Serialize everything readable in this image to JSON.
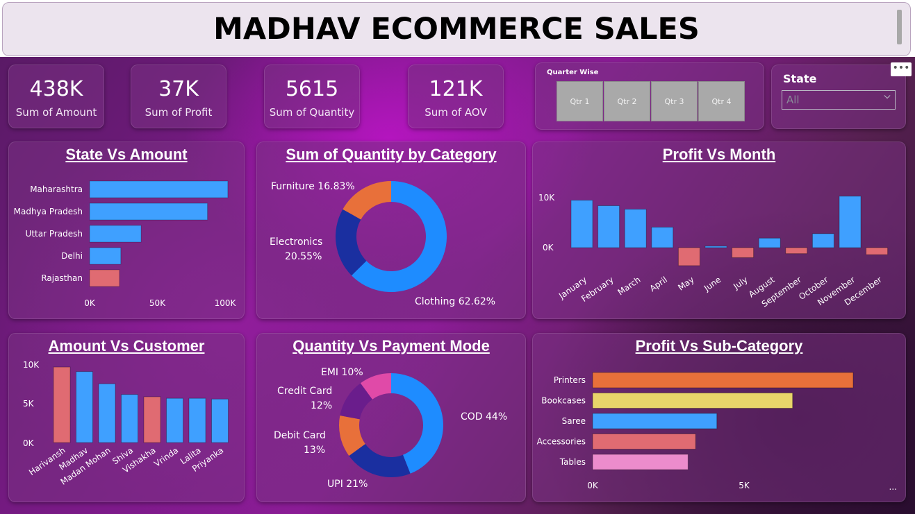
{
  "header": {
    "title": "MADHAV ECOMMERCE SALES"
  },
  "kpis": [
    {
      "value": "438K",
      "label": "Sum of Amount"
    },
    {
      "value": "37K",
      "label": "Sum of Profit"
    },
    {
      "value": "5615",
      "label": "Sum of Quantity"
    },
    {
      "value": "121K",
      "label": "Sum of AOV"
    }
  ],
  "quarter_slicer": {
    "title": "Quarter Wise",
    "options": [
      "Qtr 1",
      "Qtr 2",
      "Qtr 3",
      "Qtr 4"
    ]
  },
  "state_slicer": {
    "title": "State",
    "selected": "All"
  },
  "colors": {
    "blue": "#3fa0ff",
    "salmon": "#e06b72",
    "orange": "#e8703a",
    "navy": "#1a2fa0",
    "yellow": "#e8d56a",
    "pink": "#ec8ccc",
    "magenta": "#e04aa8",
    "purple": "#6a1d8c"
  },
  "chart_data": [
    {
      "id": "state_amount",
      "type": "bar",
      "orientation": "horizontal",
      "title": "State Vs Amount",
      "categories": [
        "Maharashtra",
        "Madhya Pradesh",
        "Uttar Pradesh",
        "Delhi",
        "Rajasthan"
      ],
      "values": [
        102000,
        87000,
        38000,
        23000,
        22000
      ],
      "bar_colors": [
        "#3fa0ff",
        "#3fa0ff",
        "#3fa0ff",
        "#3fa0ff",
        "#e06b72"
      ],
      "xlim": [
        0,
        100000
      ],
      "xticks": [
        "0K",
        "50K",
        "100K"
      ]
    },
    {
      "id": "quantity_category",
      "type": "pie",
      "donut": true,
      "title": "Sum of Quantity by Category",
      "labels": [
        "Clothing",
        "Electronics",
        "Furniture"
      ],
      "values": [
        62.62,
        20.55,
        16.83
      ],
      "display_labels": [
        "Clothing 62.62%",
        "Electronics",
        "20.55%",
        "Furniture 16.83%"
      ],
      "colors": [
        "#1e8cff",
        "#1a2fa0",
        "#e8703a"
      ]
    },
    {
      "id": "profit_month",
      "type": "bar",
      "title": "Profit Vs Month",
      "categories": [
        "January",
        "February",
        "March",
        "April",
        "May",
        "June",
        "July",
        "August",
        "September",
        "October",
        "November",
        "December"
      ],
      "values": [
        9500,
        8400,
        7700,
        4100,
        -3600,
        300,
        -2000,
        1900,
        -1200,
        2800,
        10300,
        -1400
      ],
      "yticks": [
        "10K",
        "0K"
      ],
      "ylim": [
        -5000,
        12000
      ]
    },
    {
      "id": "amount_customer",
      "type": "bar",
      "title": "Amount Vs Customer",
      "categories": [
        "Harivansh",
        "Madhav",
        "Madan Mohan",
        "Shiva",
        "Vishakha",
        "Vrinda",
        "Lalita",
        "Priyanka"
      ],
      "values": [
        9900,
        9300,
        7700,
        6300,
        6000,
        5800,
        5800,
        5700
      ],
      "bar_colors": [
        "#e06b72",
        "#3fa0ff",
        "#3fa0ff",
        "#3fa0ff",
        "#e06b72",
        "#3fa0ff",
        "#3fa0ff",
        "#3fa0ff"
      ],
      "yticks": [
        "10K",
        "5K",
        "0K"
      ],
      "ylim": [
        0,
        10000
      ]
    },
    {
      "id": "quantity_payment",
      "type": "pie",
      "donut": true,
      "title": "Quantity Vs Payment Mode",
      "labels": [
        "COD",
        "UPI",
        "Debit Card",
        "Credit Card",
        "EMI"
      ],
      "values": [
        44,
        21,
        13,
        12,
        10
      ],
      "display_labels": [
        "COD 44%",
        "UPI 21%",
        "Debit Card",
        "13%",
        "Credit Card",
        "12%",
        "EMI 10%"
      ],
      "colors": [
        "#1e8cff",
        "#1a2fa0",
        "#e8703a",
        "#6a1d8c",
        "#e04aa8"
      ]
    },
    {
      "id": "profit_subcategory",
      "type": "bar",
      "orientation": "horizontal",
      "title": "Profit Vs Sub-Category",
      "categories": [
        "Printers",
        "Bookcases",
        "Saree",
        "Accessories",
        "Tables"
      ],
      "values": [
        8600,
        6600,
        4100,
        3400,
        3150
      ],
      "bar_colors": [
        "#e8703a",
        "#e8d56a",
        "#3fa0ff",
        "#e06b72",
        "#ec8ccc"
      ],
      "xlim": [
        0,
        5000
      ],
      "xticks": [
        "0K",
        "5K"
      ],
      "more": "..."
    }
  ]
}
